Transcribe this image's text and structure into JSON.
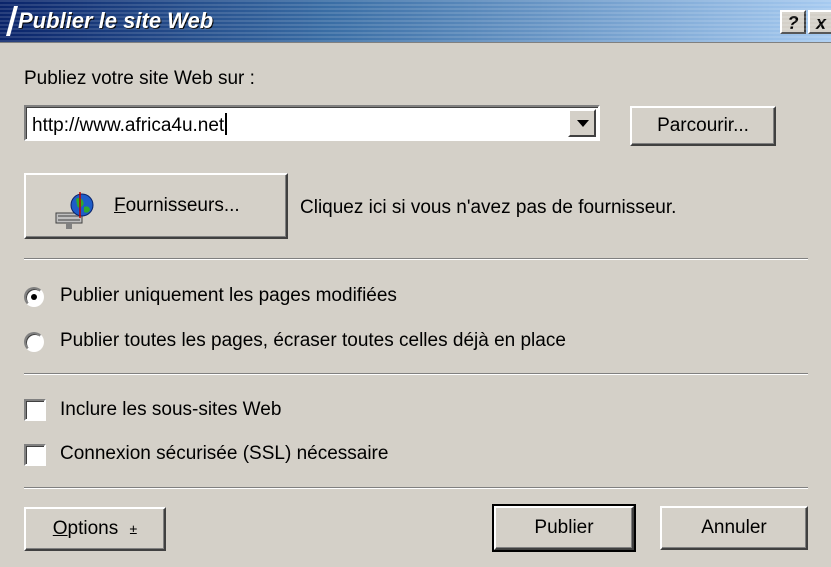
{
  "window": {
    "title": "Publier le site Web",
    "help_button": "?",
    "close_button": "x"
  },
  "publish_to": {
    "label": "Publiez votre site Web sur :",
    "url_value": "http://www.africa4u.net",
    "browse_button": "Parcourir..."
  },
  "providers": {
    "button_label": "Fournisseurs...",
    "hint": "Cliquez ici si vous n'avez pas de fournisseur."
  },
  "publish_mode": {
    "options": [
      {
        "label": "Publier uniquement les pages modifiées",
        "checked": true
      },
      {
        "label": "Publier toutes les pages, écraser toutes celles déjà en place",
        "checked": false
      }
    ]
  },
  "checkboxes": [
    {
      "label": "Inclure les sous-sites Web",
      "checked": false
    },
    {
      "label": "Connexion sécurisée (SSL) nécessaire",
      "checked": false
    }
  ],
  "footer": {
    "options_button": "Options",
    "options_arrow": "±",
    "publish_button": "Publier",
    "cancel_button": "Annuler"
  }
}
